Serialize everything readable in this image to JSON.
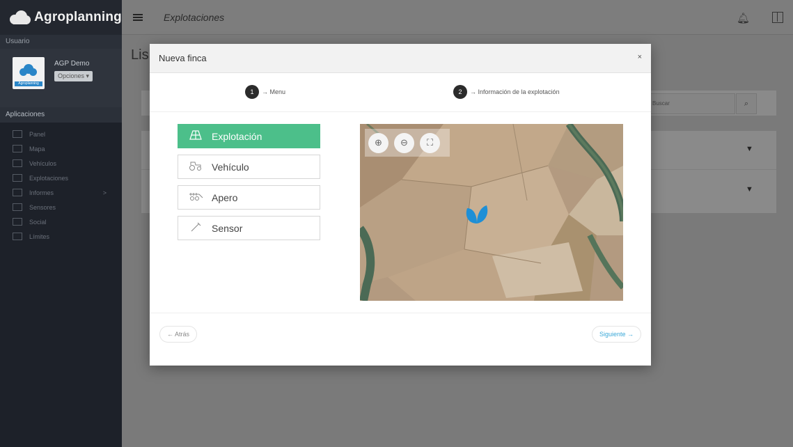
{
  "brand": {
    "name": "Agroplanning"
  },
  "sidebar": {
    "user_section_label": "Usuario",
    "user_name": "AGP Demo",
    "avatar_caption": "Agroplanning",
    "options_button": "Opciones ▾",
    "apps_section_label": "Aplicaciones",
    "items": [
      {
        "label": "Panel",
        "icon": "grid-icon"
      },
      {
        "label": "Mapa",
        "icon": "map-icon"
      },
      {
        "label": "Vehículos",
        "icon": "tractor-icon"
      },
      {
        "label": "Explotaciones",
        "icon": "field-icon"
      },
      {
        "label": "Informes",
        "icon": "report-icon",
        "arrow": ">"
      },
      {
        "label": "Sensores",
        "icon": "sensor-icon"
      },
      {
        "label": "Social",
        "icon": "social-icon"
      },
      {
        "label": "Límites",
        "icon": "limits-icon"
      }
    ]
  },
  "topbar": {
    "title": "Explotaciones"
  },
  "background": {
    "page_title": "Lis",
    "search_placeholder": "Buscar"
  },
  "modal": {
    "title": "Nueva finca",
    "close": "×",
    "steps": [
      {
        "num": "1",
        "label": "→ Menu"
      },
      {
        "num": "2",
        "label": "→ Información de la explotación"
      }
    ],
    "menu": [
      {
        "label": "Explotación",
        "icon": "field-icon",
        "active": true
      },
      {
        "label": "Vehículo",
        "icon": "tractor-icon",
        "active": false
      },
      {
        "label": "Apero",
        "icon": "implement-icon",
        "active": false
      },
      {
        "label": "Sensor",
        "icon": "sensor-icon",
        "active": false
      }
    ],
    "back_button": "← Atrás",
    "next_button": "Siguiente →"
  },
  "colors": {
    "accent_green": "#4cbf8a",
    "link_blue": "#3aa8d8",
    "sidebar_bg": "#1d2129",
    "marker_blue": "#1e8fd6"
  }
}
